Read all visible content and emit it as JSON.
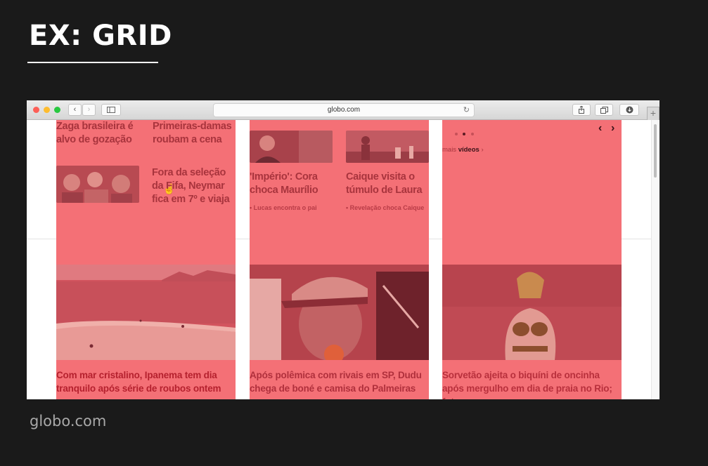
{
  "slide": {
    "title": "EX: GRID",
    "caption": "globo.com"
  },
  "browser": {
    "url": "globo.com",
    "nav_back": "‹",
    "nav_forward": "›",
    "new_tab": "+"
  },
  "grid": {
    "overlay_color": "#f46a70",
    "col1": {
      "top_left": "Zaga brasileira é alvo de gozação",
      "top_right": "Primeiras-damas roubam a cena",
      "feature": "Fora da seleção da Fifa, Neymar fica em 7º e viaja",
      "main_headline": "Com mar cristalino, Ipanema tem dia tranquilo após série de roubos ontem"
    },
    "col2": {
      "left_headline": "'Império': Cora choca Maurílio",
      "left_sub": "• Lucas encontra o pai",
      "right_headline": "Caique visita o túmulo de Laura",
      "right_sub": "• Revelação choca Caique",
      "main_headline": "Após polêmica com rivais em SP, Dudu chega de boné e camisa do Palmeiras"
    },
    "col3": {
      "nav_prev": "‹",
      "nav_next": "›",
      "more_prefix": "mais ",
      "more_strong": "vídeos",
      "more_arrow": " ›",
      "main_headline": "Sorvetão ajeita o biquíni de oncinha após mergulho em dia de praia no Rio; fotos"
    }
  }
}
